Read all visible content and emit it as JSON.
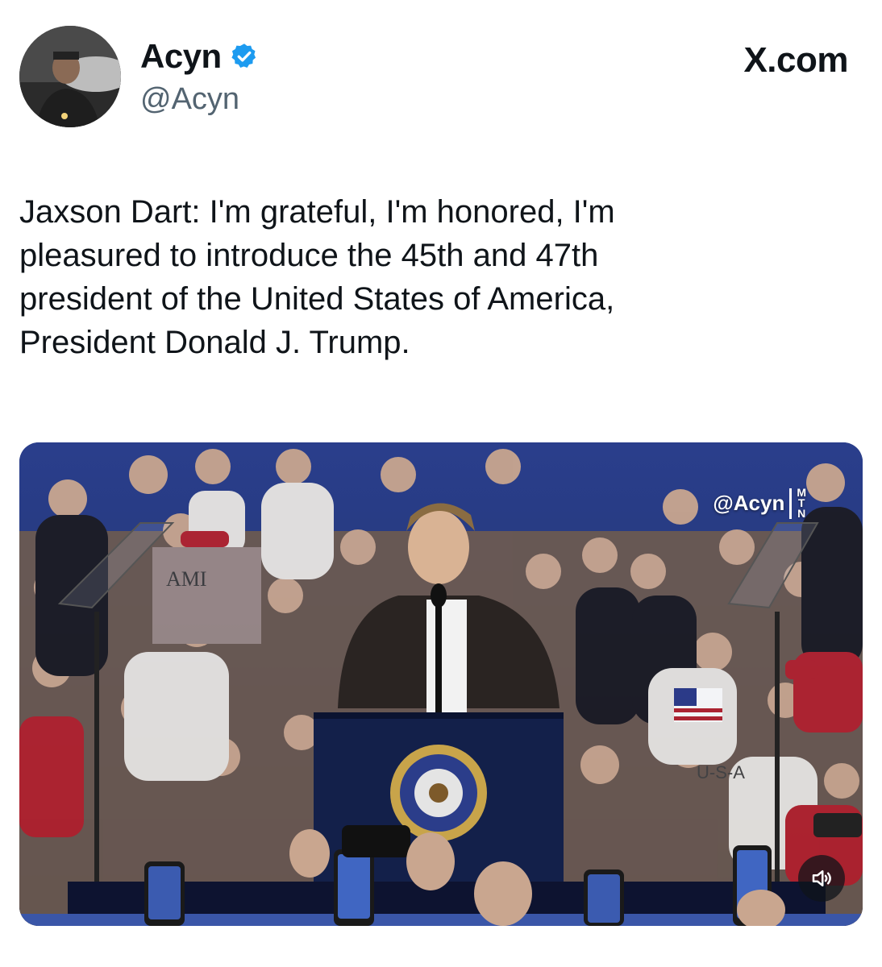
{
  "user": {
    "display_name": "Acyn",
    "handle": "@Acyn",
    "verified_icon": "verified-badge-icon",
    "accent_color": "#1d9bf0"
  },
  "brand": {
    "label": "X.com"
  },
  "post": {
    "text": "Jaxson Dart: I'm grateful, I'm honored, I'm\npleasured to introduce the 45th and 47th\npresident of the United States of America,\nPresident Donald J. Trump."
  },
  "media": {
    "watermark": "@Acyn",
    "watermark_letters": [
      "M",
      "T",
      "N"
    ],
    "sound_icon": "speaker-icon",
    "sign_text": "AMI",
    "shirt_text": "U-S-A"
  }
}
